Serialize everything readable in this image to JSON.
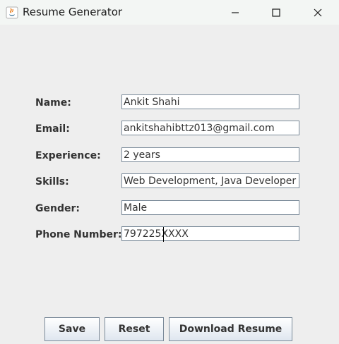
{
  "window": {
    "title": "Resume Generator",
    "icon": "java-icon",
    "controls": [
      "minimize-icon",
      "maximize-icon",
      "close-icon"
    ]
  },
  "form": {
    "name_label": "Name:",
    "name_value": "Ankit Shahi",
    "email_label": "Email:",
    "email_value": "ankitshahibttz013@gmail.com",
    "experience_label": "Experience:",
    "experience_value": "2 years",
    "skills_label": "Skills:",
    "skills_value": "Web Development, Java Developer",
    "gender_label": "Gender:",
    "gender_value": "Male",
    "phone_label": "Phone Number:",
    "phone_value": "797225XXXX"
  },
  "buttons": {
    "save": "Save",
    "reset": "Reset",
    "download": "Download Resume"
  }
}
